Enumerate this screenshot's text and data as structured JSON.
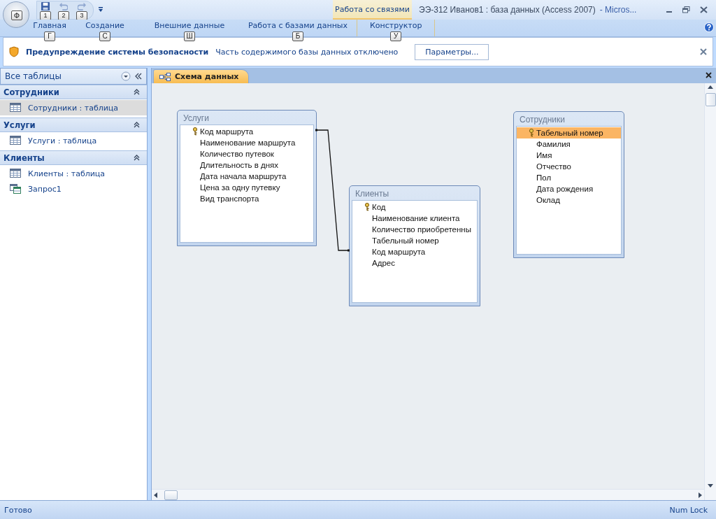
{
  "office_button": {
    "key_tip": "Ф"
  },
  "quick_access": [
    {
      "kind": "save",
      "key_tip": "1",
      "disabled": false
    },
    {
      "kind": "undo",
      "key_tip": "2",
      "disabled": true
    },
    {
      "kind": "redo",
      "key_tip": "3",
      "disabled": true
    }
  ],
  "contextual_tab_group": {
    "label": "Работа со связями"
  },
  "window": {
    "title": "ЭЭ-312 Иванов1 : база данных (Access 2007)",
    "app": "- Micros..."
  },
  "ribbon_tabs": [
    {
      "label": "Главная",
      "key_tip": "Г",
      "selected": false
    },
    {
      "label": "Создание",
      "key_tip": "С",
      "selected": false
    },
    {
      "label": "Внешние данные",
      "key_tip": "Ш",
      "selected": false
    },
    {
      "label": "Работа с базами данных",
      "key_tip": "Б",
      "selected": false
    },
    {
      "label": "Конструктор",
      "key_tip": "У",
      "selected": false,
      "kind": "contextual"
    }
  ],
  "security_bar": {
    "title": "Предупреждение системы безопасности",
    "message": "Часть содержимого базы данных отключено",
    "button": "Параметры..."
  },
  "navigation_pane": {
    "title": "Все таблицы",
    "groups": [
      {
        "title": "Сотрудники",
        "expanded": true,
        "items": [
          {
            "kind": "table",
            "label": "Сотрудники : таблица",
            "selected": true
          }
        ]
      },
      {
        "title": "Услуги",
        "expanded": true,
        "items": [
          {
            "kind": "table",
            "label": "Услуги : таблица",
            "selected": false
          }
        ]
      },
      {
        "title": "Клиенты",
        "expanded": true,
        "items": [
          {
            "kind": "table",
            "label": "Клиенты : таблица",
            "selected": false
          },
          {
            "kind": "query",
            "label": "Запрос1",
            "selected": false
          }
        ]
      }
    ]
  },
  "document_tabs": [
    {
      "label": "Схема данных",
      "selected": true
    }
  ],
  "diagram": {
    "tables": [
      {
        "title": "Услуги",
        "fields": [
          {
            "name": "Код маршрута",
            "key": true,
            "selected": false
          },
          {
            "name": "Наименование маршрута",
            "key": false,
            "selected": false
          },
          {
            "name": "Количество путевок",
            "key": false,
            "selected": false
          },
          {
            "name": "Длительность в днях",
            "key": false,
            "selected": false
          },
          {
            "name": "Дата начала маршрута",
            "key": false,
            "selected": false
          },
          {
            "name": "Цена за одну путевку",
            "key": false,
            "selected": false
          },
          {
            "name": "Вид транспорта",
            "key": false,
            "selected": false
          }
        ]
      },
      {
        "title": "Клиенты",
        "fields": [
          {
            "name": "Код",
            "key": true,
            "selected": false
          },
          {
            "name": "Наименование клиента",
            "key": false,
            "selected": false
          },
          {
            "name": "Количество приобретенны",
            "key": false,
            "selected": false
          },
          {
            "name": "Табельный номер",
            "key": false,
            "selected": false
          },
          {
            "name": "Код маршрута",
            "key": false,
            "selected": false
          },
          {
            "name": "Адрес",
            "key": false,
            "selected": false
          }
        ]
      },
      {
        "title": "Сотрудники",
        "fields": [
          {
            "name": "Табельный номер",
            "key": true,
            "selected": true
          },
          {
            "name": "Фамилия",
            "key": false,
            "selected": false
          },
          {
            "name": "Имя",
            "key": false,
            "selected": false
          },
          {
            "name": "Отчество",
            "key": false,
            "selected": false
          },
          {
            "name": "Пол",
            "key": false,
            "selected": false
          },
          {
            "name": "Дата рождения",
            "key": false,
            "selected": false
          },
          {
            "name": "Оклад",
            "key": false,
            "selected": false
          }
        ]
      }
    ]
  },
  "status_bar": {
    "left": "Готово",
    "right": "Num Lock"
  }
}
